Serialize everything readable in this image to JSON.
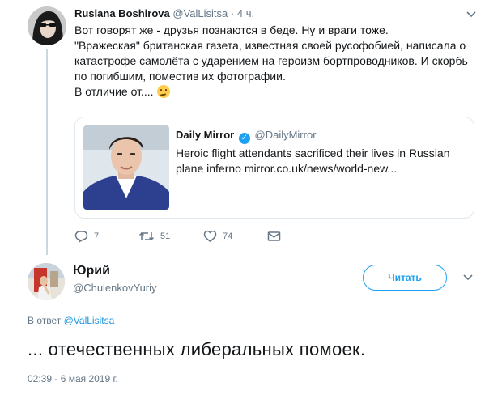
{
  "tweet1": {
    "author": {
      "name": "Ruslana Boshirova",
      "handle": "@ValLisitsa"
    },
    "separator": "·",
    "time": "4 ч.",
    "text_lines": [
      "Вот говорят же - друзья познаются в беде. Ну и враги тоже.",
      "\"Вражеская\" британская газета, известная своей русофобией, написала о",
      "катастрофе самолёта с ударением на героизм бортпроводников. И скорбь",
      "по погибшим, поместив их фотографии.",
      "В отличие от...."
    ],
    "emoji_icon": "thinking-face-icon",
    "quoted": {
      "name": "Daily Mirror",
      "handle": "@DailyMirror",
      "verified_icon": "verified-badge-icon",
      "text_lines": [
        "Heroic flight attendants sacrificed their lives in Russian",
        "plane inferno mirror.co.uk/news/world-new..."
      ]
    },
    "actions": {
      "reply_count": "7",
      "retweet_count": "51",
      "like_count": "74"
    }
  },
  "tweet2": {
    "author": {
      "name": "Юрий",
      "handle": "@ChulenkovYuriy"
    },
    "follow_label": "Читать",
    "reply_prefix": "В ответ",
    "reply_mention": "@ValLisitsa",
    "text": "... отечественных либеральных помоек.",
    "date": "02:39 - 6 мая 2019 г."
  },
  "colors": {
    "accent": "#1da1f2",
    "secondary_text": "#657786",
    "border": "#e1e8ed"
  }
}
